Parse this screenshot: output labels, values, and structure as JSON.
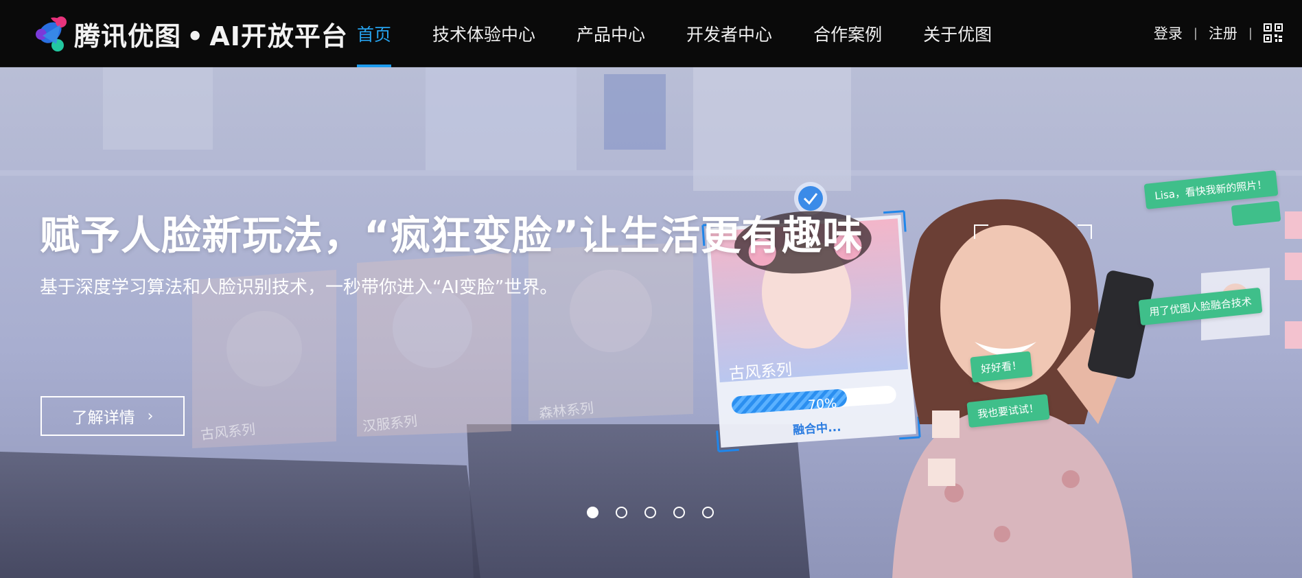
{
  "brand": {
    "name": "腾讯优图",
    "separator": "•",
    "product": "AI开放平台",
    "logo_icon": "youtu-logo-icon"
  },
  "nav": {
    "items": [
      {
        "label": "首页",
        "active": true
      },
      {
        "label": "技术体验中心",
        "active": false
      },
      {
        "label": "产品中心",
        "active": false
      },
      {
        "label": "开发者中心",
        "active": false
      },
      {
        "label": "合作案例",
        "active": false
      },
      {
        "label": "关于优图",
        "active": false
      }
    ]
  },
  "auth": {
    "login": "登录",
    "register": "注册",
    "sep": "|",
    "qr_icon": "qr-code-icon"
  },
  "hero": {
    "headline": "赋予人脸新玩法，“疯狂变脸”让生活更有趣味",
    "subhead": "基于深度学习算法和人脸识别技术，一秒带你进入“AI变脸”世界。",
    "cta_label": "了解详情",
    "cta_icon": "chevron-right-icon",
    "card_labels": [
      "古风系列",
      "汉服系列",
      "森林系列"
    ],
    "fusion_card": {
      "title": "古风系列",
      "progress": 0.7,
      "progress_label": "70%",
      "status": "融合中..."
    },
    "bubbles": [
      "Lisa，看快我新的照片！",
      "用了优图人脸融合技术",
      "好好看！",
      "我也要试试！"
    ],
    "carousel": {
      "count": 5,
      "active_index": 0
    }
  },
  "colors": {
    "nav_active": "#26a3ef",
    "bubble": "#3fbf8a",
    "overlay": "#8e94c2"
  }
}
